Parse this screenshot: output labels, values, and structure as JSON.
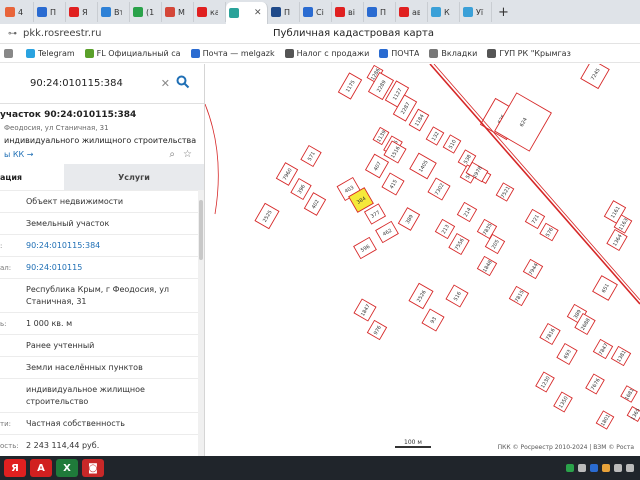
{
  "browser": {
    "tabs": [
      {
        "label": "4",
        "icon": "mail-icon",
        "color": "#e8643a"
      },
      {
        "label": "П",
        "icon": "page-icon",
        "color": "#2a6bd1"
      },
      {
        "label": "Я",
        "icon": "yandex-icon",
        "color": "#e02020"
      },
      {
        "label": "Вт",
        "icon": "vk-icon",
        "color": "#2d81d7"
      },
      {
        "label": "(1",
        "icon": "counter-icon",
        "color": "#2aa24a"
      },
      {
        "label": "M",
        "icon": "gmail-icon",
        "color": "#d44638"
      },
      {
        "label": "ка",
        "icon": "yandex-icon",
        "color": "#e02020"
      },
      {
        "label": "",
        "icon": "rosreestr-icon",
        "color": "#2aa39a",
        "active": true
      },
      {
        "label": "П",
        "icon": "page-icon",
        "color": "#1f4a8a"
      },
      {
        "label": "Сі",
        "icon": "page-icon",
        "color": "#2a6bd1"
      },
      {
        "label": "ві",
        "icon": "yandex-icon",
        "color": "#e02020"
      },
      {
        "label": "П",
        "icon": "page-icon",
        "color": "#2a6bd1"
      },
      {
        "label": "ав",
        "icon": "yandex-icon",
        "color": "#e02020"
      },
      {
        "label": "К",
        "icon": "page-icon",
        "color": "#3aa0d8"
      },
      {
        "label": "Уї",
        "icon": "page-icon",
        "color": "#3aa0d8"
      }
    ],
    "new_tab": "+",
    "url": "pkk.rosreestr.ru",
    "page_title": "Публичная кадастровая карта",
    "bookmarks": [
      {
        "label": "",
        "icon": "bookmark-icon",
        "color": "#888"
      },
      {
        "label": "Telegram",
        "icon": "telegram-icon",
        "color": "#2aa3e0"
      },
      {
        "label": "FL Официальный са",
        "icon": "fl-icon",
        "color": "#5aa02a"
      },
      {
        "label": "Почта — melgazk",
        "icon": "mail-icon",
        "color": "#2a6bd1"
      },
      {
        "label": "Налог с продажи",
        "icon": "doc-icon",
        "color": "#555"
      },
      {
        "label": "ПОЧТА",
        "icon": "mail-icon",
        "color": "#2a6bd1"
      },
      {
        "label": "Вкладки",
        "icon": "folder-icon",
        "color": "#777"
      },
      {
        "label": "ГУП РК \"Крымгаз",
        "icon": "doc-icon",
        "color": "#555"
      }
    ]
  },
  "panel": {
    "search_value": "90:24:010115:384",
    "object_title": "участок 90:24:010115:384",
    "object_address": "Феодосия, ул Станичная, 31",
    "object_type": "индивидуального жилищного строительства",
    "kk_link": "ы КК →",
    "tabs": {
      "info": "ация",
      "services": "Услуги"
    },
    "rows": [
      {
        "label": "",
        "value": "Объект недвижимости",
        "link": false
      },
      {
        "label": "",
        "value": "Земельный участок",
        "link": false
      },
      {
        "label": ":",
        "value": "90:24:010115:384",
        "link": true
      },
      {
        "label": "ал:",
        "value": "90:24:010115",
        "link": true
      },
      {
        "label": "",
        "value": "Республика Крым, г Феодосия, ул Станичная, 31",
        "link": false
      },
      {
        "label": "ь:",
        "value": "1 000 кв. м",
        "link": false
      },
      {
        "label": "",
        "value": "Ранее учтенный",
        "link": false
      },
      {
        "label": "",
        "value": "Земли населённых пунктов",
        "link": false
      },
      {
        "label": "",
        "value": "индивидуальное жилищное строительство",
        "link": false
      },
      {
        "label": "ти:",
        "value": "Частная собственность",
        "link": false
      },
      {
        "label": "ость:",
        "value": "2 243 114,44 руб.",
        "link": false
      }
    ]
  },
  "map": {
    "scale_label": "100 м",
    "attribution": "ПКК © Росреестр 2010-2024 | ВЗМ © Роста",
    "highlight_color": "#f5e93a",
    "line_color": "#d62828",
    "selected_parcel_label": "384",
    "parcels": [
      "1175",
      "1286",
      "2289",
      "1127",
      "2287",
      "1184",
      "626",
      "1139",
      "1125",
      "132",
      "510",
      "538",
      "504",
      "1183",
      "1516",
      "407",
      "415",
      "1405",
      "7302",
      "2978",
      "624",
      "7245",
      "571",
      "7960",
      "396",
      "402",
      "403",
      "384",
      "377",
      "389",
      "2525",
      "462",
      "596",
      "7521",
      "213",
      "214",
      "7835",
      "7556",
      "205",
      "721",
      "576",
      "1161",
      "1163",
      "1364",
      "1848",
      "7944",
      "2526",
      "1847",
      "976",
      "93",
      "516",
      "7815",
      "651",
      "7816",
      "389",
      "2688",
      "1381",
      "7847",
      "693",
      "1230",
      "1350",
      "7676",
      "1801",
      "1681",
      "1365"
    ]
  },
  "taskbar": {
    "items": [
      {
        "icon": "yandex-browser-icon",
        "color": "#e02020",
        "label": "Я"
      },
      {
        "icon": "pdf-icon",
        "color": "#d12020",
        "label": "A"
      },
      {
        "icon": "excel-icon",
        "color": "#1f7a3a",
        "label": "X"
      },
      {
        "icon": "camera-icon",
        "color": "#c82828",
        "label": "◙"
      }
    ]
  }
}
